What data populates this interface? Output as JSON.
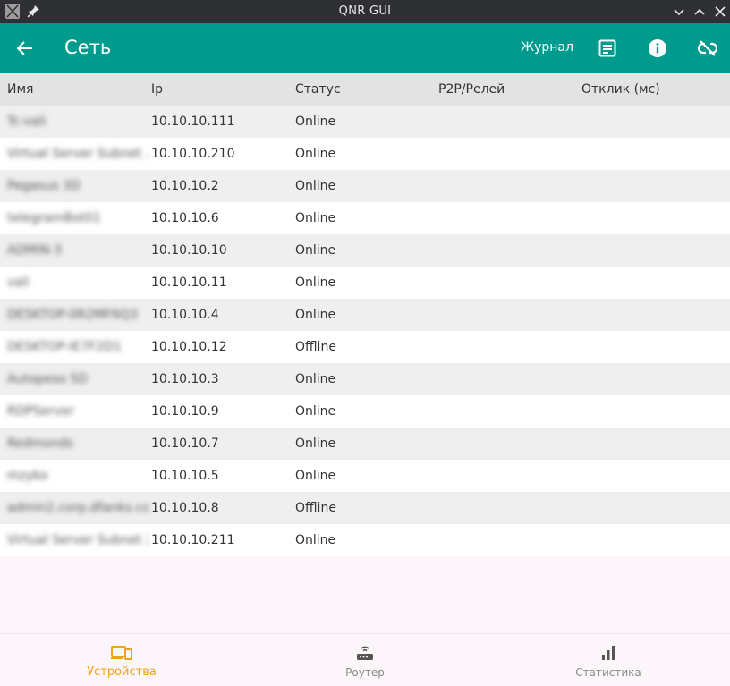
{
  "window": {
    "title": "QNR GUI",
    "app_icon": "x-app-icon",
    "buttons": [
      "pin-icon",
      "minimize-icon",
      "maximize-icon",
      "close-icon"
    ]
  },
  "appbar": {
    "title": "Сеть",
    "journal_label": "Журнал",
    "accent": "#009b8d"
  },
  "table": {
    "headers": [
      "Имя",
      "Ip",
      "Статус",
      "P2P/Релей",
      "Отклик (мс)"
    ],
    "rows": [
      {
        "name": "Tc-vali",
        "ip": "10.10.10.111",
        "status": "Online",
        "p2p": "",
        "latency": ""
      },
      {
        "name": "Virtual Server Subnet ...",
        "ip": "10.10.10.210",
        "status": "Online",
        "p2p": "",
        "latency": ""
      },
      {
        "name": "Pegasus 3D",
        "ip": "10.10.10.2",
        "status": "Online",
        "p2p": "",
        "latency": ""
      },
      {
        "name": "telegramBot01",
        "ip": "10.10.10.6",
        "status": "Online",
        "p2p": "",
        "latency": ""
      },
      {
        "name": "ADMIN-3",
        "ip": "10.10.10.10",
        "status": "Online",
        "p2p": "",
        "latency": ""
      },
      {
        "name": "vali",
        "ip": "10.10.10.11",
        "status": "Online",
        "p2p": "",
        "latency": ""
      },
      {
        "name": "DESKTOP-0R2MF6Q3",
        "ip": "10.10.10.4",
        "status": "Online",
        "p2p": "",
        "latency": ""
      },
      {
        "name": "DESKTOP-IE7F2D1",
        "ip": "10.10.10.12",
        "status": "Offline",
        "p2p": "",
        "latency": ""
      },
      {
        "name": "Autopeso 5D",
        "ip": "10.10.10.3",
        "status": "Online",
        "p2p": "",
        "latency": ""
      },
      {
        "name": "RDPServer",
        "ip": "10.10.10.9",
        "status": "Online",
        "p2p": "",
        "latency": ""
      },
      {
        "name": "Redmonds",
        "ip": "10.10.10.7",
        "status": "Online",
        "p2p": "",
        "latency": ""
      },
      {
        "name": "mzyko",
        "ip": "10.10.10.5",
        "status": "Online",
        "p2p": "",
        "latency": ""
      },
      {
        "name": "admin2.corp.dfanks.com",
        "ip": "10.10.10.8",
        "status": "Offline",
        "p2p": "",
        "latency": ""
      },
      {
        "name": "Virtual Server Subnet 2",
        "ip": "10.10.10.211",
        "status": "Online",
        "p2p": "",
        "latency": ""
      }
    ]
  },
  "bottomnav": {
    "items": [
      {
        "label": "Устройства",
        "icon": "devices-icon",
        "active": true
      },
      {
        "label": "Роутер",
        "icon": "router-icon",
        "active": false
      },
      {
        "label": "Статистика",
        "icon": "bar-chart-icon",
        "active": false
      }
    ],
    "active_color": "#f2a11a"
  }
}
